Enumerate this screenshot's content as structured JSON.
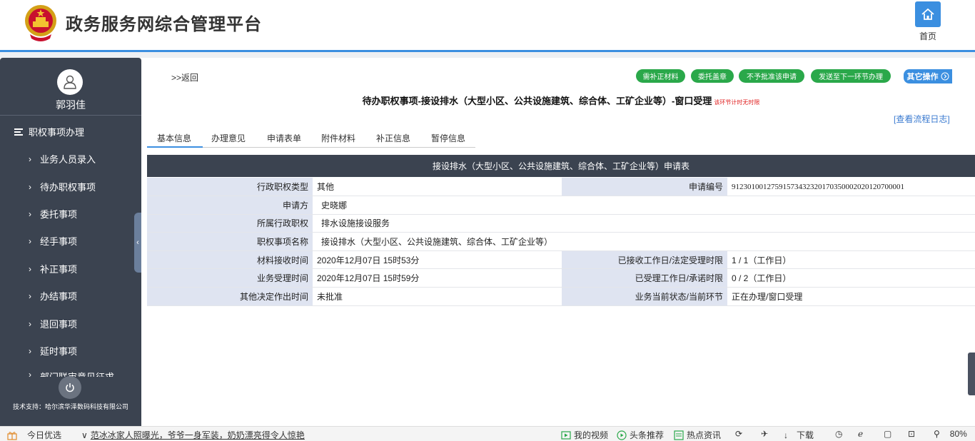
{
  "header": {
    "title": "政务服务网综合管理平台",
    "home_label": "首页"
  },
  "sidebar": {
    "username": "郭羽佳",
    "section": "职权事项办理",
    "items": [
      "业务人员录入",
      "待办职权事项",
      "委托事项",
      "经手事项",
      "补正事项",
      "办结事项",
      "退回事项",
      "延时事项",
      "部门联审意见征求"
    ],
    "support": "技术支持：哈尔滨华泽数码科技有限公司"
  },
  "main": {
    "back": ">>返回",
    "actions": [
      "需补正材料",
      "委托盖章",
      "不予批准该申请",
      "发送至下一环节办理"
    ],
    "other_action": "其它操作",
    "page_title": "待办职权事项-接设排水（大型小区、公共设施建筑、综合体、工矿企业等）-窗口受理",
    "title_note": "该环节计时无时限",
    "log_link": "[查看流程日志]",
    "tabs": [
      "基本信息",
      "办理意见",
      "申请表单",
      "附件材料",
      "补正信息",
      "暂停信息"
    ],
    "form_title": "接设排水（大型小区、公共设施建筑、综合体、工矿企业等）申请表",
    "form": {
      "type_label": "行政职权类型",
      "type_value": "其他",
      "apply_no_label": "申请编号",
      "apply_no_value": "91230100127591573432320170350002020120700001",
      "applicant_label": "申请方",
      "applicant_value": "史晓娜",
      "power_label": "所属行政职权",
      "power_value": "排水设施接设服务",
      "item_label": "职权事项名称",
      "item_value": "接设排水（大型小区、公共设施建筑、综合体、工矿企业等）",
      "receive_time_label": "材料接收时间",
      "receive_time_value": "2020年12月07日 15时53分",
      "received_days_label": "已接收工作日/法定受理时限",
      "received_days_value": "1 / 1（工作日）",
      "accept_time_label": "业务受理时间",
      "accept_time_value": "2020年12月07日 15时59分",
      "accepted_days_label": "已受理工作日/承诺时限",
      "accepted_days_value": "0 / 2（工作日）",
      "decision_time_label": "其他决定作出时间",
      "decision_time_value": "未批准",
      "status_label": "业务当前状态/当前环节",
      "status_value": "正在办理/窗口受理"
    }
  },
  "statusbar": {
    "daily": "今日优选",
    "news": "范冰冰家人照曝光，爷爷一身军装，奶奶漂亮得令人惊艳",
    "video": "我的视频",
    "headline": "头条推荐",
    "hot": "热点资讯",
    "download": "下载",
    "zoom": "80%"
  },
  "colors": {
    "accent": "#3b8fe0",
    "sidebar": "#3b4350",
    "action_green": "#2aa84a",
    "label_bg": "#dfe4f1"
  }
}
